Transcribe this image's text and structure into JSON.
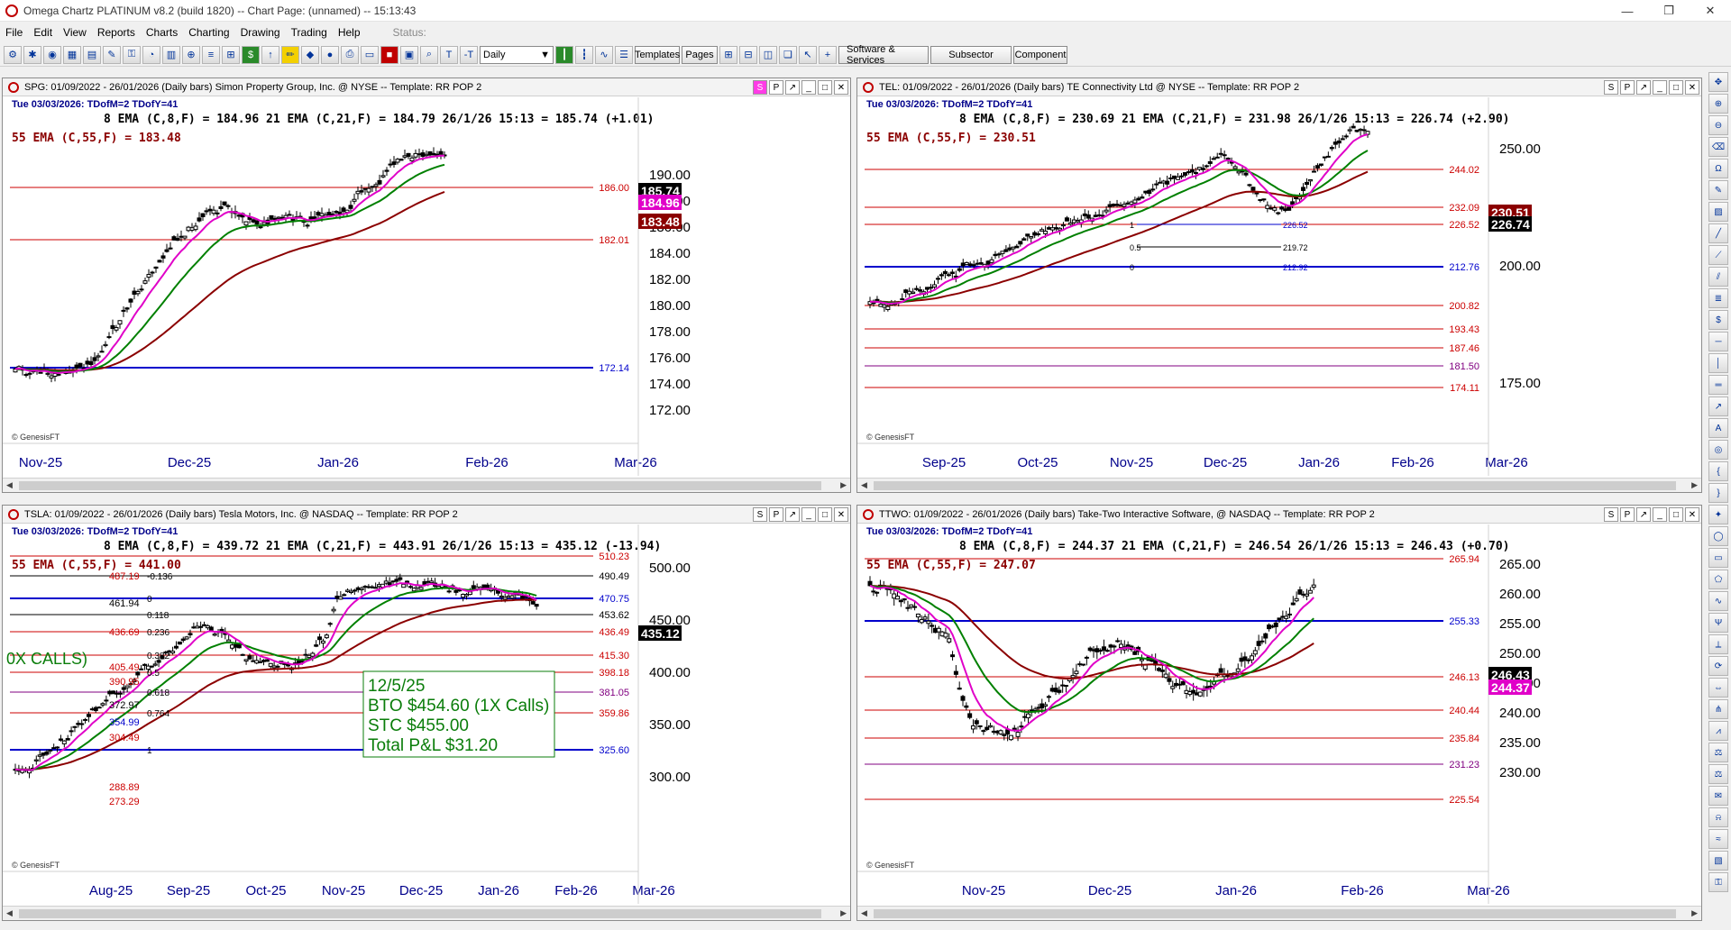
{
  "app": {
    "title": "Omega Chartz PLATINUM v8.2 (build 1820)  --  Chart Page: (unnamed)  --  15:13:43",
    "window_controls": [
      "—",
      "❐",
      "✕"
    ]
  },
  "menu": [
    "File",
    "Edit",
    "View",
    "Reports",
    "Charts",
    "Charting",
    "Drawing",
    "Trading",
    "Help"
  ],
  "status_label": "Status:",
  "toolbar": {
    "period_select": "Daily",
    "buttons": [
      "Templates",
      "Pages",
      "Software & Services",
      "Subsector",
      "Component"
    ]
  },
  "colors": {
    "ema8": "#e000c8",
    "ema21": "#008000",
    "ema55": "#8b0000",
    "blue_line": "#0000cc",
    "red_line": "#cc0000",
    "purple_line": "#800080"
  },
  "charts": [
    {
      "id": "spg",
      "header": "SPG: 01/09/2022 - 26/01/2026  (Daily bars)   Simon Property Group, Inc. @ NYSE  --  Template: RR POP 2",
      "date_line": "Tue  03/03/2026:  TDofM=2  TDofY=41",
      "ema_line1": "8 EMA (C,8,F) = 184.96  21 EMA (C,21,F) = 184.79  26/1/26 15:13 = 185.74 (+1.01)",
      "ema_line2": "55 EMA (C,55,F) = 183.48",
      "copyright": "© GenesisFT",
      "y_ticks": [
        "190.00",
        "188.00",
        "186.00",
        "184.00",
        "182.00",
        "180.00",
        "178.00",
        "176.00",
        "174.00",
        "172.00"
      ],
      "x_ticks": [
        "Nov-25",
        "Dec-25",
        "Jan-26",
        "Feb-26",
        "Mar-26"
      ],
      "levels": [
        {
          "label": "186.00",
          "kind": "red"
        },
        {
          "label": "182.01",
          "kind": "red"
        },
        {
          "label": "172.14",
          "kind": "blue"
        }
      ],
      "price_tags": [
        {
          "text": "185.74",
          "kind": "black"
        },
        {
          "text": "184.96",
          "kind": "magenta"
        },
        {
          "text": "183.48",
          "kind": "maroon"
        }
      ]
    },
    {
      "id": "tel",
      "header": "TEL: 01/09/2022 - 26/01/2026  (Daily bars)   TE Connectivity Ltd @ NYSE  --  Template: RR POP 2",
      "date_line": "Tue  03/03/2026:  TDofM=2  TDofY=41",
      "ema_line1": "8 EMA (C,8,F) = 230.69  21 EMA (C,21,F) = 231.98  26/1/26 15:13 = 226.74 (+2.90)",
      "ema_line2": "55 EMA (C,55,F) = 230.51",
      "copyright": "© GenesisFT",
      "y_ticks": [
        "250.00",
        "200.00",
        "175.00"
      ],
      "x_ticks": [
        "Sep-25",
        "Oct-25",
        "Nov-25",
        "Dec-25",
        "Jan-26",
        "Feb-26",
        "Mar-26"
      ],
      "levels": [
        {
          "label": "244.02",
          "kind": "red"
        },
        {
          "label": "232.09",
          "kind": "red"
        },
        {
          "label": "226.52",
          "kind": "red"
        },
        {
          "label": "212.76",
          "kind": "blue"
        },
        {
          "label": "200.82",
          "kind": "red"
        },
        {
          "label": "193.43",
          "kind": "red"
        },
        {
          "label": "187.46",
          "kind": "red"
        },
        {
          "label": "181.50",
          "kind": "purple"
        },
        {
          "label": "174.11",
          "kind": "red"
        }
      ],
      "fib": [
        {
          "ratio": "1",
          "label": "226.52"
        },
        {
          "ratio": "0.5",
          "label": "219.72"
        },
        {
          "ratio": "0",
          "label": "212.92"
        }
      ],
      "price_tags": [
        {
          "text": "230.51",
          "kind": "maroon"
        },
        {
          "text": "226.74",
          "kind": "black"
        }
      ]
    },
    {
      "id": "tsla",
      "header": "TSLA: 01/09/2022 - 26/01/2026  (Daily bars)   Tesla Motors, Inc. @ NASDAQ  --  Template: RR POP 2",
      "date_line": "Tue  03/03/2026:  TDofM=2  TDofY=41",
      "ema_line1": "8 EMA (C,8,F) = 439.72  21 EMA (C,21,F) = 443.91  26/1/26 15:13 = 435.12 (-13.94)",
      "ema_line2": "55 EMA (C,55,F) = 441.00",
      "copyright": "© GenesisFT",
      "y_ticks": [
        "500.00",
        "450.00",
        "400.00",
        "350.00",
        "300.00"
      ],
      "x_ticks": [
        "Aug-25",
        "Sep-25",
        "Oct-25",
        "Nov-25",
        "Dec-25",
        "Jan-26",
        "Feb-26",
        "Mar-26"
      ],
      "right_levels": [
        {
          "label": "510.23",
          "kind": "red"
        },
        {
          "label": "490.49",
          "kind": "black"
        },
        {
          "label": "470.75",
          "kind": "blue"
        },
        {
          "label": "453.62",
          "kind": "black"
        },
        {
          "label": "436.49",
          "kind": "red"
        },
        {
          "label": "415.30",
          "kind": "red"
        },
        {
          "label": "398.18",
          "kind": "red"
        },
        {
          "label": "381.05",
          "kind": "purple"
        },
        {
          "label": "359.86",
          "kind": "red"
        },
        {
          "label": "325.60",
          "kind": "blue"
        }
      ],
      "left_levels": [
        {
          "label": "487.19",
          "kind": "red"
        },
        {
          "label": "461.94",
          "kind": "black"
        },
        {
          "label": "436.69",
          "kind": "red"
        },
        {
          "label": "405.49",
          "kind": "red"
        },
        {
          "label": "390.95",
          "kind": "red"
        },
        {
          "label": "372.97",
          "kind": "black"
        },
        {
          "label": "354.99",
          "kind": "blue"
        },
        {
          "label": "304.49",
          "kind": "red"
        },
        {
          "label": "288.89",
          "kind": "red"
        },
        {
          "label": "273.29",
          "kind": "red"
        }
      ],
      "fib": [
        "-0.136",
        "0",
        "0.118",
        "0.236",
        "0.382",
        "0.5",
        "0.618",
        "0.764",
        "1"
      ],
      "trade_box": [
        "12/5/25",
        "BTO $454.60 (1X Calls)",
        "STC $455.00",
        "Total P&L $31.20"
      ],
      "clipped_text": "0X CALLS)",
      "price_tags": [
        {
          "text": "435.12",
          "kind": "black"
        }
      ]
    },
    {
      "id": "ttwo",
      "header": "TTWO: 01/09/2022 - 26/01/2026  (Daily bars)   Take-Two Interactive Software, @ NASDAQ  --  Template: RR POP 2",
      "date_line": "Tue  03/03/2026:  TDofM=2  TDofY=41",
      "ema_line1": "8 EMA (C,8,F) = 244.37  21 EMA (C,21,F) = 246.54  26/1/26 15:13 = 246.43 (+0.70)",
      "ema_line2": "55 EMA (C,55,F) = 247.07",
      "copyright": "© GenesisFT",
      "y_ticks": [
        "265.00",
        "260.00",
        "255.00",
        "250.00",
        "245.00",
        "240.00",
        "235.00",
        "230.00"
      ],
      "x_ticks": [
        "Nov-25",
        "Dec-25",
        "Jan-26",
        "Feb-26",
        "Mar-26"
      ],
      "levels": [
        {
          "label": "265.94",
          "kind": "red"
        },
        {
          "label": "255.33",
          "kind": "blue"
        },
        {
          "label": "246.13",
          "kind": "red"
        },
        {
          "label": "240.44",
          "kind": "red"
        },
        {
          "label": "235.84",
          "kind": "red"
        },
        {
          "label": "231.23",
          "kind": "purple"
        },
        {
          "label": "225.54",
          "kind": "red"
        }
      ],
      "price_tags": [
        {
          "text": "246.43",
          "kind": "black"
        },
        {
          "text": "244.37",
          "kind": "magenta"
        }
      ]
    }
  ]
}
